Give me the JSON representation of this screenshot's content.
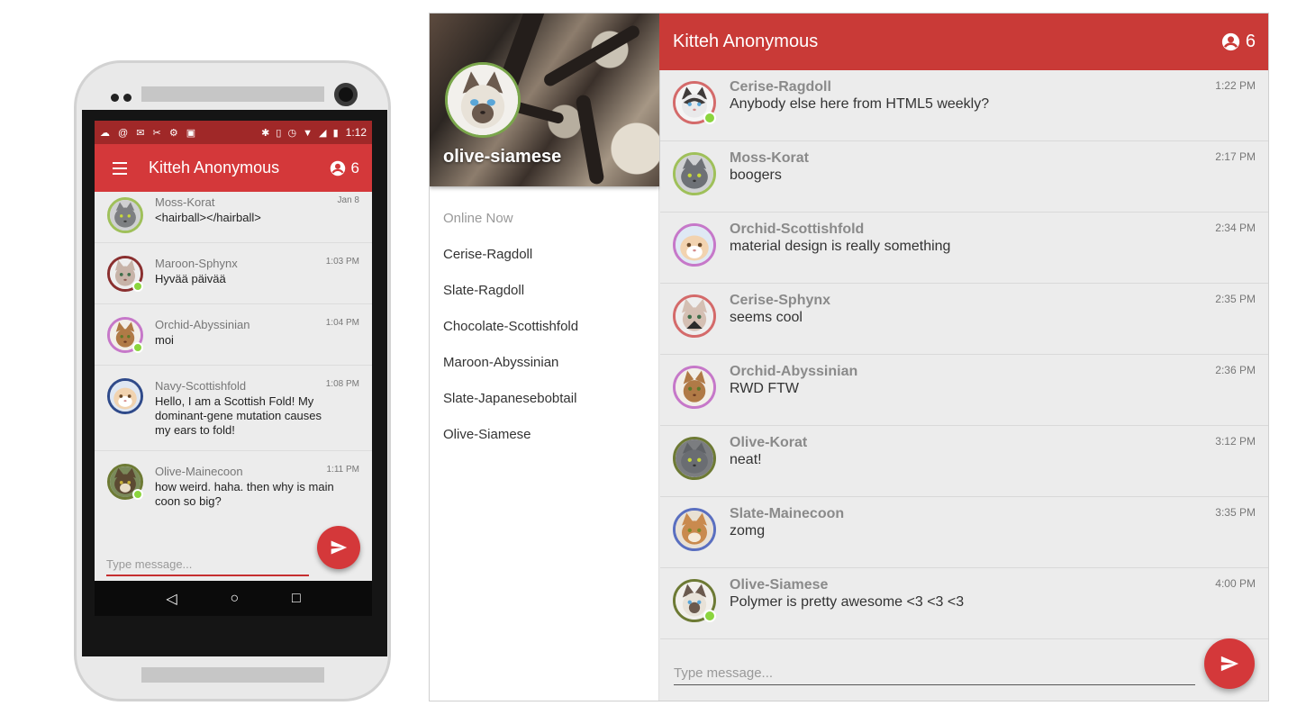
{
  "colors": {
    "accent": "#d4383a",
    "online": "#8bd53e"
  },
  "phone": {
    "status_bar": {
      "time": "1:12"
    },
    "app_bar": {
      "menu_icon": "menu-icon",
      "title": "Kitteh Anonymous",
      "count": "6",
      "count_icon": "account-circle-icon"
    },
    "messages": [
      {
        "name": "Moss-Korat",
        "text": "<hairball></hairball>",
        "time": "Jan 8",
        "ring": "#9fc05a",
        "fur": "#7d7f82",
        "online": false
      },
      {
        "name": "Maroon-Sphynx",
        "text": "Hyvää päivää",
        "time": "1:03 PM",
        "ring": "#8a2f2f",
        "fur": "#c7b3a8",
        "online": true
      },
      {
        "name": "Orchid-Abyssinian",
        "text": "moi",
        "time": "1:04 PM",
        "ring": "#c678c9",
        "fur": "#b07a46",
        "online": true
      },
      {
        "name": "Navy-Scottishfold",
        "text": "Hello, I am a Scottish Fold! My dominant-gene mutation causes my ears to fold!",
        "time": "1:08 PM",
        "ring": "#2f4a8a",
        "fur": "#f1d3b0",
        "online": false
      },
      {
        "name": "Olive-Mainecoon",
        "text": "how weird. haha. then why is main coon so big?",
        "time": "1:11 PM",
        "ring": "#6d7a34",
        "fur": "#5c4a33",
        "online": true
      }
    ],
    "input_placeholder": "Type message...",
    "send_icon": "send-icon",
    "nav": {
      "back": "◁",
      "home": "○",
      "recents": "□"
    }
  },
  "desktop": {
    "drawer": {
      "username": "olive-siamese",
      "online_heading": "Online Now",
      "online_users": [
        "Cerise-Ragdoll",
        "Slate-Ragdoll",
        "Chocolate-Scottishfold",
        "Maroon-Abyssinian",
        "Slate-Japanesebobtail",
        "Olive-Siamese"
      ]
    },
    "app_bar": {
      "title": "Kitteh Anonymous",
      "count": "6",
      "count_icon": "account-circle-icon"
    },
    "messages": [
      {
        "name": "Cerise-Ragdoll",
        "text": "Anybody else here from HTML5 weekly?",
        "time": "1:22 PM",
        "ring": "#d46a6a",
        "fur": "#e9e9ea",
        "online": true
      },
      {
        "name": "Moss-Korat",
        "text": "boogers",
        "time": "2:17 PM",
        "ring": "#9fc05a",
        "fur": "#6e7176",
        "online": false
      },
      {
        "name": "Orchid-Scottishfold",
        "text": "material design is really something",
        "time": "2:34 PM",
        "ring": "#c678c9",
        "fur": "#f2d3b0",
        "online": false
      },
      {
        "name": "Cerise-Sphynx",
        "text": "seems cool",
        "time": "2:35 PM",
        "ring": "#d46a6a",
        "fur": "#d4bfb3",
        "online": false
      },
      {
        "name": "Orchid-Abyssinian",
        "text": "RWD FTW",
        "time": "2:36 PM",
        "ring": "#c678c9",
        "fur": "#b07a46",
        "online": false
      },
      {
        "name": "Olive-Korat",
        "text": "neat!",
        "time": "3:12 PM",
        "ring": "#6d7a34",
        "fur": "#6a6d72",
        "online": false
      },
      {
        "name": "Slate-Mainecoon",
        "text": "zomg",
        "time": "3:35 PM",
        "ring": "#5a6fc0",
        "fur": "#c98a4e",
        "online": false
      },
      {
        "name": "Olive-Siamese",
        "text": "Polymer is pretty awesome <3 <3 <3",
        "time": "4:00 PM",
        "ring": "#6d7a34",
        "fur": "#e8e2d8",
        "online": true
      }
    ],
    "input_placeholder": "Type message...",
    "send_icon": "send-icon"
  }
}
